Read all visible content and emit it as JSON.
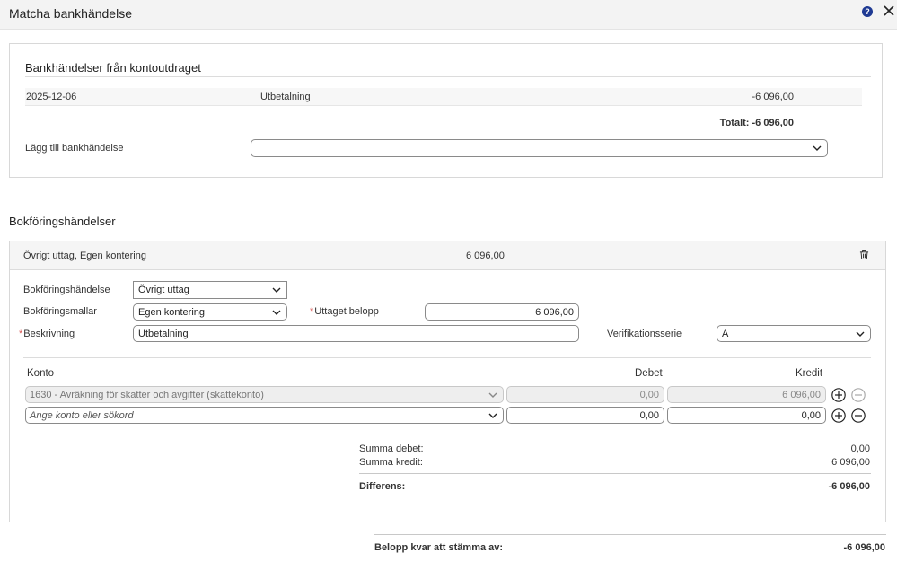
{
  "dialog": {
    "title": "Matcha bankhändelse",
    "help_glyph": "?"
  },
  "bank_section": {
    "title": "Bankhändelser från kontoutdraget",
    "row": {
      "date": "2025-12-06",
      "text": "Utbetalning",
      "amount": "-6 096,00"
    },
    "total": "Totalt: -6 096,00",
    "add_label": "Lägg till bankhändelse",
    "add_select_value": ""
  },
  "booking_section": {
    "title": "Bokföringshändelser",
    "item": {
      "title": "Övrigt uttag, Egen kontering",
      "amount": "6 096,00"
    },
    "form": {
      "event_label": "Bokföringshändelse",
      "event_value": "Övrigt uttag",
      "template_label": "Bokföringsmallar",
      "template_value": "Egen kontering",
      "required_mark": "*",
      "withdrawn_label": "Uttaget belopp",
      "withdrawn_value": "6 096,00",
      "description_label": "Beskrivning",
      "description_value": "Utbetalning",
      "series_label": "Verifikationsserie",
      "series_value": "A"
    },
    "accounts": {
      "headers": {
        "account": "Konto",
        "debit": "Debet",
        "credit": "Kredit"
      },
      "rows": [
        {
          "account": "1630 - Avräkning för skatter och avgifter (skattekonto)",
          "debit": "0,00",
          "credit": "6 096,00"
        }
      ],
      "new_row": {
        "placeholder": "Ange konto eller sökord",
        "debit": "0,00",
        "credit": "0,00"
      }
    },
    "sums": {
      "debit_label": "Summa debet:",
      "debit_value": "0,00",
      "credit_label": "Summa kredit:",
      "credit_value": "6 096,00",
      "diff_label": "Differens:",
      "diff_value": "-6 096,00"
    }
  },
  "footer": {
    "remaining_label": "Belopp kvar att stämma av:",
    "remaining_value": "-6 096,00"
  }
}
